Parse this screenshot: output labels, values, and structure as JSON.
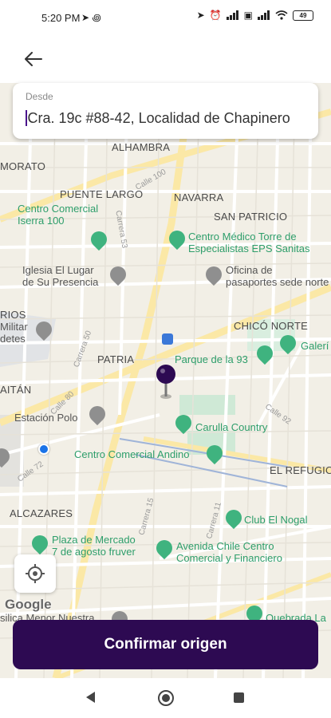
{
  "status_bar": {
    "time": "5:20 PM",
    "left_icons": "➤ ꩜",
    "battery": "49"
  },
  "header": {
    "back_icon": "arrow-left-icon"
  },
  "origin_field": {
    "label": "Desde",
    "value": "Cra. 19c #88-42, Localidad de Chapinero"
  },
  "map": {
    "areas": [
      "ALHAMBRA",
      "MORATO",
      "PUENTE LARGO",
      "NAVARRA",
      "SAN PATRICIO",
      "CHICÓ NORTE",
      "PATRIA",
      "AITÁN",
      "EL REFUGIO",
      "ALCAZARES",
      "RIOS"
    ],
    "pois": {
      "centro_comercial_iserra": "Centro Comercial\nIserra 100",
      "centro_medico": "Centro Médico Torre de\nEspecialistas EPS Sanitas",
      "iglesia": "Iglesia El Lugar\nde Su Presencia",
      "oficina_pasaportes": "Oficina de\npasaportes sede norte",
      "militar": "Militar\ndetes",
      "parque_93": "Parque de la 93",
      "galeria": "Galerí",
      "estacion_polo": "Estación Polo",
      "carulla": "Carulla Country",
      "centro_andino": "Centro Comercial Andino",
      "club_nogal": "Club El Nogal",
      "plaza_mercado": "Plaza de Mercado\n7 de agosto fruver",
      "avenida_chile": "Avenida Chile Centro\nComercial y Financiero",
      "basilica": "silica Menor Nuestra",
      "quebrada": "Quebrada La"
    },
    "roads": {
      "calle_100": "Calle 100",
      "carrera_53": "Carrera 53",
      "carrera_50": "Carrera 50",
      "calle_80": "Calle 80",
      "calle_72": "Calle 72",
      "calle_92": "Calle 92",
      "carrera_15": "Carrera 15",
      "carrera_11": "Carrera 11"
    },
    "attribution": "Google"
  },
  "locate_button": {
    "icon": "crosshair-icon"
  },
  "confirm_button": {
    "label": "Confirmar origen"
  },
  "colors": {
    "primary": "#2d0a52",
    "pin": "#2d0a52",
    "poi_green": "#3fb37f"
  }
}
